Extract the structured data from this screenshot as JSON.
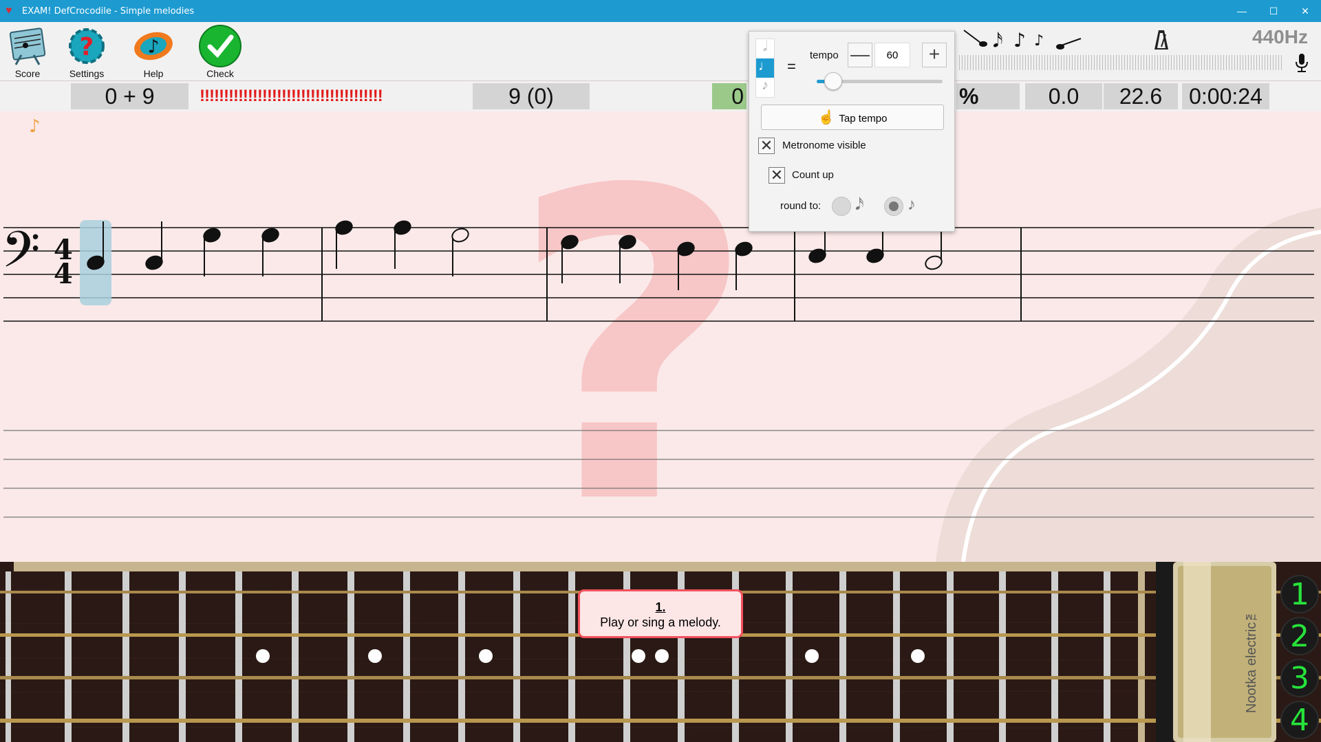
{
  "window": {
    "title": "EXAM! DefCrocodile - Simple melodies",
    "minimize": "—",
    "maximize": "☐",
    "close": "✕"
  },
  "toolbar": {
    "score_label": "Score",
    "settings_label": "Settings",
    "help_label": "Help",
    "check_label": "Check"
  },
  "pitch": {
    "frequency": "440Hz"
  },
  "results": {
    "answers": "0 + 9",
    "mistakes": "!!!!!!!!!!!!!!!!!!!!!!!!!!!!!!!!!!!!!!",
    "questions": "9 (0)",
    "good": "0",
    "percent": "%",
    "effectiveness": "0.0",
    "avg_time": "22.6",
    "total_time": "0:00:24"
  },
  "metronome": {
    "equals": "=",
    "tempo_label": "tempo",
    "tempo_value": "60",
    "tempo_slider_fraction": 0.13,
    "minus": "—",
    "plus": "+",
    "tap_tempo": "Tap tempo",
    "metronome_visible": "Metronome visible",
    "metronome_visible_checked": true,
    "count_up": "Count up",
    "count_up_checked": true,
    "round_to_label": "round to:",
    "check_mark": "✕"
  },
  "hint": {
    "number": "1.",
    "text": "Play or sing a melody."
  },
  "strings": [
    "1",
    "2",
    "3",
    "4"
  ],
  "guitar_brand": "Nootka electric™",
  "colors": {
    "titlebar": "#1d9bd1",
    "mistake_red": "#e21a1a",
    "string_number_green": "#26e33a",
    "highlight_blue": "#a8d0de",
    "slider_blue": "#1d9bd1"
  }
}
